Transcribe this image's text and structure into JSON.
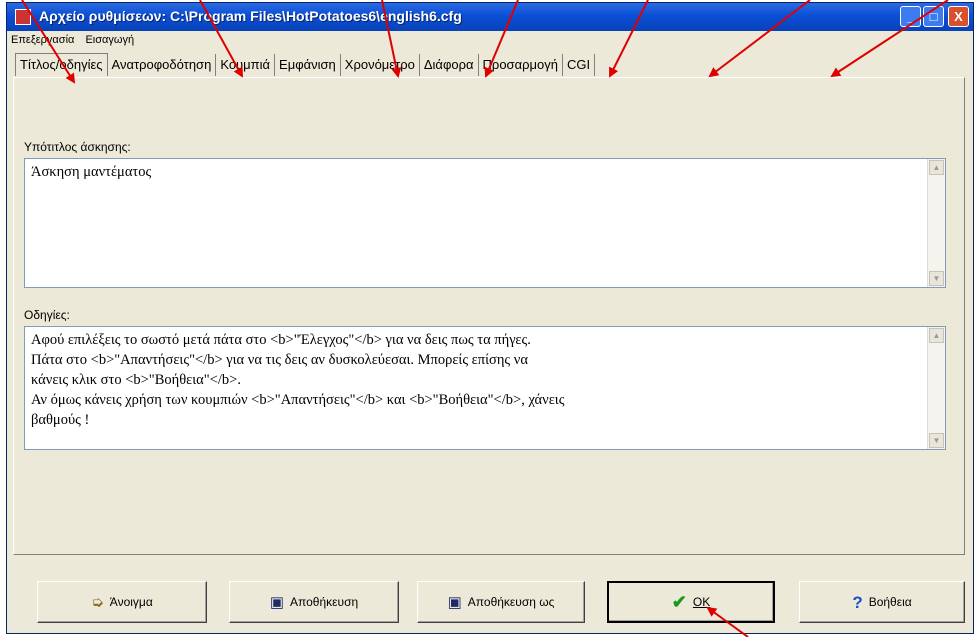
{
  "window": {
    "title": "Αρχείο ρυθμίσεων:  C:\\Program Files\\HotPotatoes6\\english6.cfg",
    "controls": {
      "minimize": "_",
      "maximize": "□",
      "close": "X"
    }
  },
  "menu": [
    "Επεξεργασία",
    "Εισαγωγή"
  ],
  "tabs": [
    "Τίτλος/οδηγίες",
    "Ανατροφοδότηση",
    "Κουμπιά",
    "Εμφάνιση",
    "Χρονόμετρο",
    "Διάφορα",
    "Προσαρμογή",
    "CGI"
  ],
  "subtitle": {
    "label": "Υπότιτλος άσκησης:",
    "value": "Άσκηση μαντέματος"
  },
  "instructions": {
    "label": "Οδηγίες:",
    "lines": [
      "Αφού επιλέξεις το σωστό μετά πάτα στο  <b>\"Έλεγχος\"</b> για να δεις πως τα πήγες.",
      "Πάτα στο <b>\"Απαντήσεις\"</b> για να τις δεις αν δυσκολεύεσαι. Μπορείς επίσης να",
      "κάνεις κλικ στο <b>\"Βοήθεια\"</b>.",
      "Αν όμως κάνεις χρήση των κουμπιών <b>\"Απαντήσεις\"</b> και <b>\"Βοήθεια\"</b>, χάνεις",
      "βαθμούς !"
    ]
  },
  "buttons": {
    "open": "Άνοιγμα",
    "save": "Αποθήκευση",
    "save_as": "Αποθήκευση ως",
    "ok": "OK",
    "help": "Βοήθεια"
  },
  "colors": {
    "titlebar": "#0a4fd6",
    "face": "#ece9d8",
    "annotation_arrow": "#e00000",
    "ok_check": "#1a9a1a",
    "help_icon": "#1a4fc8",
    "save_icon": "#202a6a"
  }
}
